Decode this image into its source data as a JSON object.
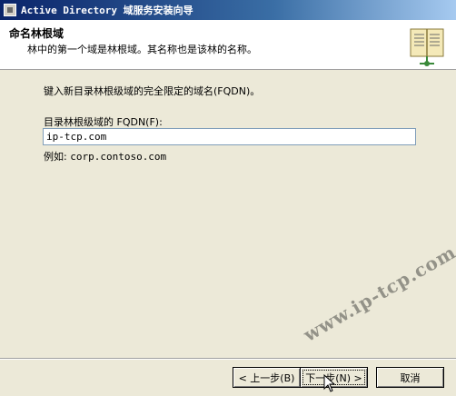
{
  "window": {
    "title": "Active Directory 域服务安装向导"
  },
  "header": {
    "title": "命名林根域",
    "subtitle": "林中的第一个域是林根域。其名称也是该林的名称。",
    "icon": "book-icon"
  },
  "content": {
    "prompt": "键入新目录林根级域的完全限定的域名(FQDN)。",
    "fqdn_label": "目录林根级域的 FQDN(F):",
    "fqdn_value": "ip-tcp.com",
    "example_label": "例如:",
    "example_value": "corp.contoso.com"
  },
  "buttons": {
    "back": "< 上一步(B)",
    "next": "下一步(N) >",
    "cancel": "取消"
  },
  "watermark": "www.ip-tcp.com",
  "colors": {
    "titlebar_start": "#0a246a",
    "titlebar_end": "#a6caf0",
    "dialog_bg": "#ece9d8",
    "header_bg": "#ffffff"
  }
}
